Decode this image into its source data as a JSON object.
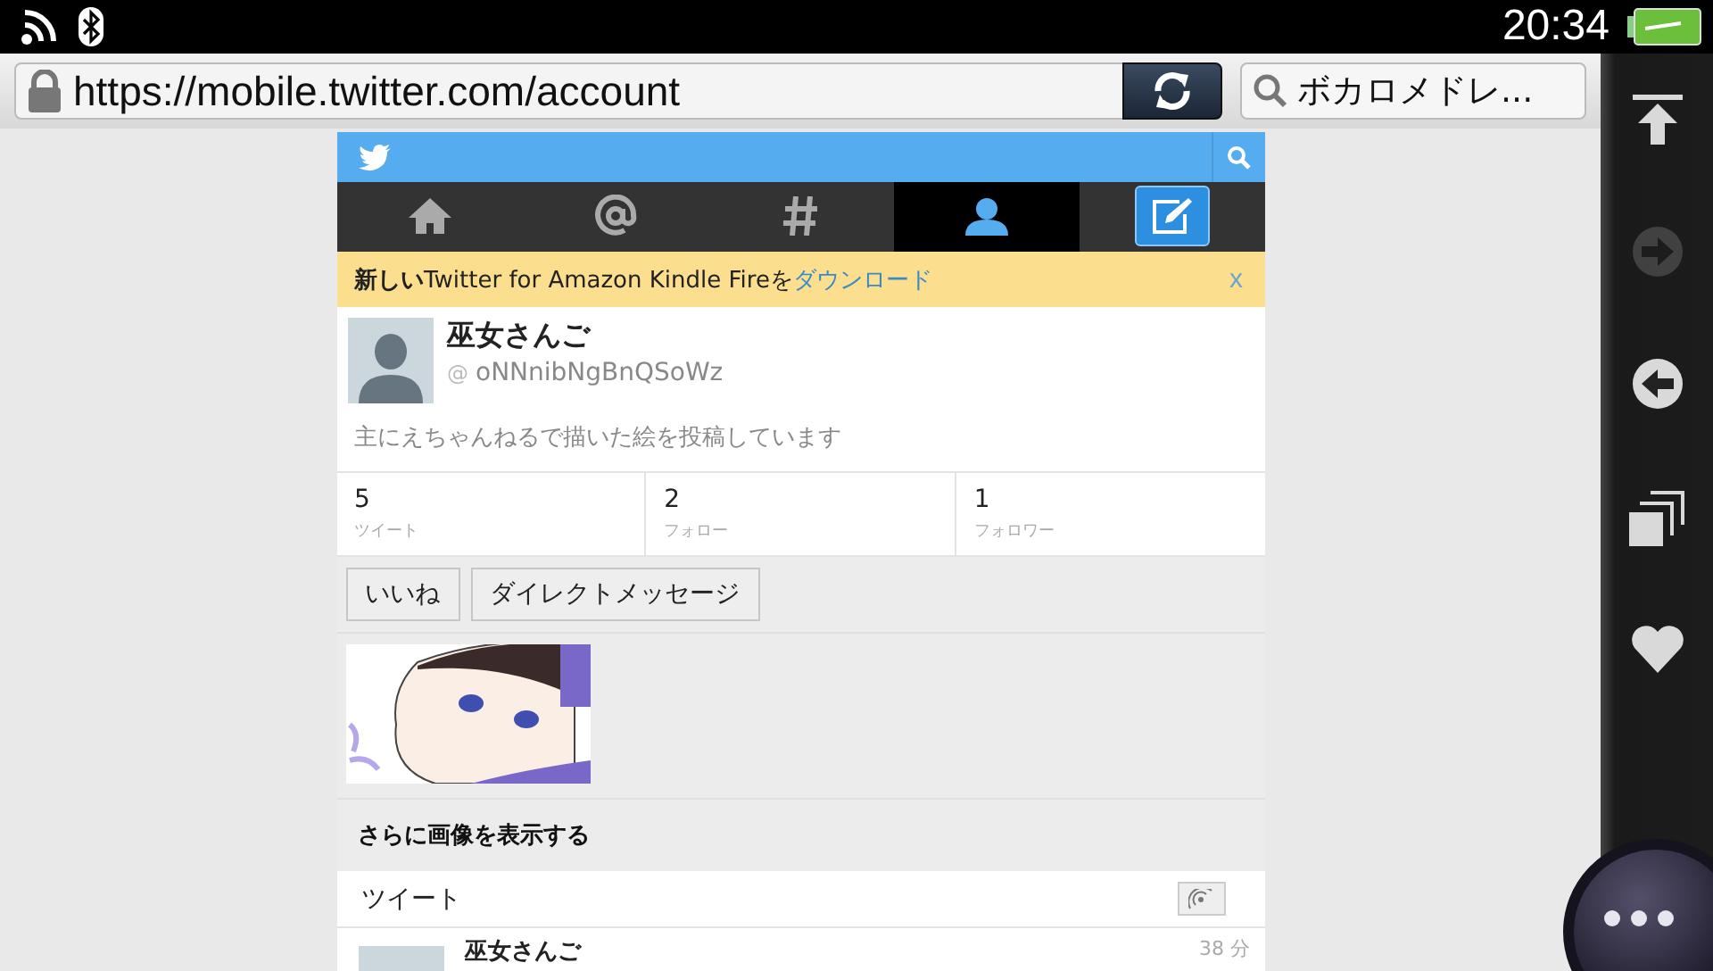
{
  "status_bar": {
    "time": "20:34"
  },
  "address_bar": {
    "url": "https://mobile.twitter.com/account",
    "search": "ボカロメドレ..."
  },
  "side_toolbar": [
    {
      "kind": "top",
      "disabled": false
    },
    {
      "kind": "forward",
      "disabled": true
    },
    {
      "kind": "back",
      "disabled": false
    },
    {
      "kind": "windows",
      "disabled": false
    },
    {
      "kind": "favorite",
      "disabled": false
    }
  ],
  "nav_tabs": [
    {
      "kind": "home",
      "selected": false
    },
    {
      "kind": "mention",
      "selected": false
    },
    {
      "kind": "hashtag",
      "selected": false
    },
    {
      "kind": "profile",
      "selected": true
    },
    {
      "kind": "compose",
      "selected": false
    }
  ],
  "banner": {
    "text": "**新しい**Twitter for Amazon Kindle Fireを",
    "link": "ダウンロード",
    "close": "x"
  },
  "profile": {
    "name": "巫女さんご",
    "handle": "oNNnibNgBnQSoWz",
    "at": "@",
    "bio": "主にえちゃんねるで描いた絵を投稿しています"
  },
  "stats": [
    {
      "value": "5",
      "label": "ツイート"
    },
    {
      "value": "2",
      "label": "フォロー"
    },
    {
      "value": "1",
      "label": "フォロワー"
    }
  ],
  "actions": [
    "いいね",
    "ダイレクトメッセージ"
  ],
  "more_images": "さらに画像を表示する",
  "tweets_header": "ツイート",
  "tweet": {
    "name": "巫女さんご",
    "time": "38 分"
  }
}
